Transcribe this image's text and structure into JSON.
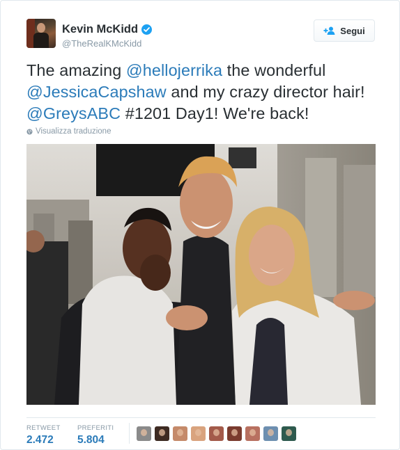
{
  "user": {
    "display_name": "Kevin McKidd",
    "handle": "@TheRealKMcKidd",
    "verified_icon": "verified-badge-icon"
  },
  "follow_button": {
    "label": "Segui",
    "icon": "add-user-icon"
  },
  "tweet": {
    "parts": [
      {
        "text": "The amazing ",
        "link": false
      },
      {
        "text": "@hellojerrika",
        "link": true
      },
      {
        "text": " the wonderful ",
        "link": false
      },
      {
        "text": "@JessicaCapshaw",
        "link": true
      },
      {
        "text": " and my crazy director hair! ",
        "link": false
      },
      {
        "text": "@GreysABC",
        "link": true
      },
      {
        "text": " #1201 Day1! We're back!",
        "link": false
      }
    ]
  },
  "translate": {
    "label": "Visualizza traduzione",
    "icon": "globe-icon"
  },
  "stats": {
    "retweet_label": "RETWEET",
    "retweet_count": "2.472",
    "favorites_label": "PREFERITI",
    "favorites_count": "5.804"
  },
  "colors": {
    "link": "#2b7bb9",
    "muted": "#8899a6",
    "text": "#292f33",
    "verified": "#1da1f2",
    "border": "#e1e8ed"
  },
  "favoriter_avatars": [
    {
      "color": "#8a8a8a"
    },
    {
      "color": "#3d2a22"
    },
    {
      "color": "#c58a6a"
    },
    {
      "color": "#d9a37e"
    },
    {
      "color": "#a35a4a"
    },
    {
      "color": "#7a3b2e"
    },
    {
      "color": "#b87060"
    },
    {
      "color": "#6d8fb0"
    },
    {
      "color": "#2e5a4e"
    }
  ]
}
